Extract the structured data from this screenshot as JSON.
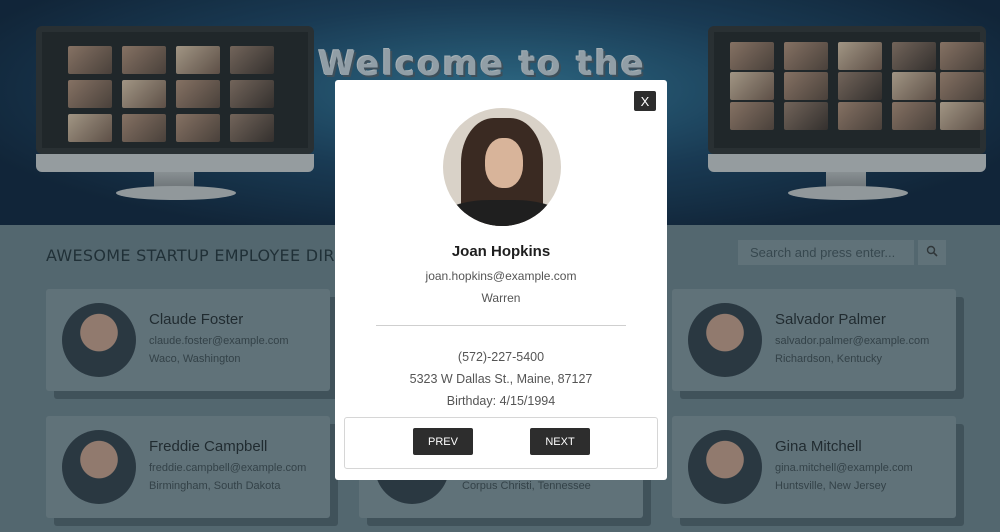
{
  "banner": {
    "title": "Welcome to the"
  },
  "directory": {
    "title": "AWESOME STARTUP EMPLOYEE DIREC",
    "search": {
      "placeholder": "Search and press enter...",
      "icon": "magnifier-icon"
    }
  },
  "employees": [
    {
      "name": "Claude Foster",
      "email": "claude.foster@example.com",
      "location": "Waco, Washington"
    },
    {
      "name": "Salvador Palmer",
      "email": "salvador.palmer@example.com",
      "location": "Richardson, Kentucky"
    },
    {
      "name": "Freddie Campbell",
      "email": "freddie.campbell@example.com",
      "location": "Birmingham, South Dakota"
    },
    {
      "name": "Gina Mitchell",
      "email": "gina.mitchell@example.com",
      "location": "Huntsville, New Jersey"
    }
  ],
  "partial_card": {
    "location": "Corpus Christi, Tennessee"
  },
  "modal": {
    "close_label": "X",
    "name": "Joan Hopkins",
    "email": "joan.hopkins@example.com",
    "city": "Warren",
    "phone": "(572)-227-5400",
    "address": "5323 W Dallas St., Maine, 87127",
    "birthday": "Birthday: 4/15/1994",
    "prev_label": "PREV",
    "next_label": "NEXT"
  }
}
